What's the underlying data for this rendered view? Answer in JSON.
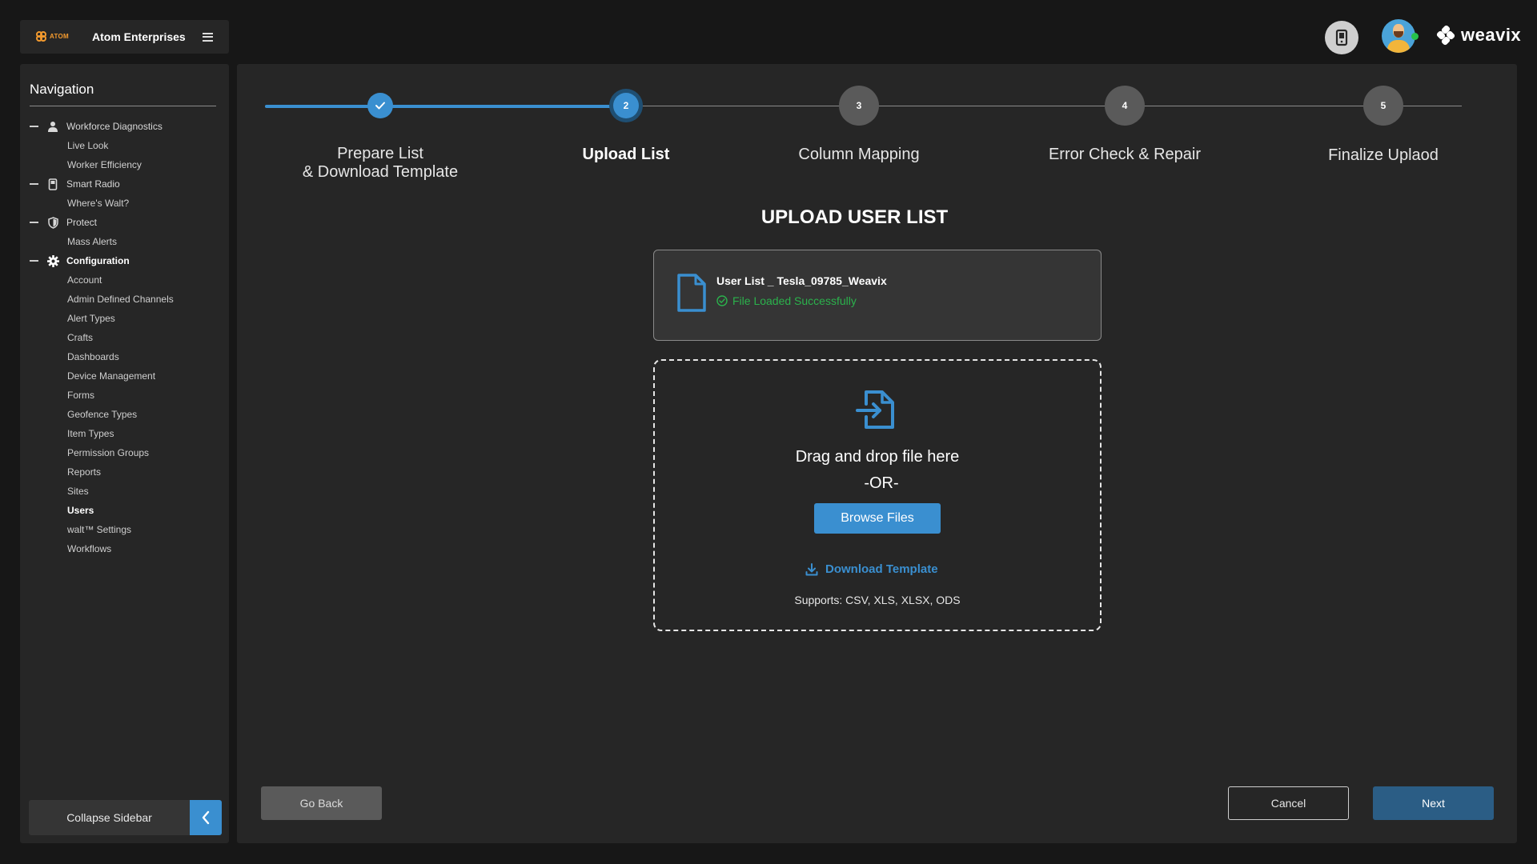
{
  "brand": {
    "logo_text": "ATOM",
    "company": "Atom Enterprises"
  },
  "header": {
    "product_logo": "weavix"
  },
  "sidebar": {
    "title": "Navigation",
    "groups": [
      {
        "label": "Workforce Diagnostics",
        "icon": "person-icon",
        "items": [
          "Live Look",
          "Worker Efficiency"
        ]
      },
      {
        "label": "Smart Radio",
        "icon": "radio-icon",
        "items": [
          "Where's Walt?"
        ]
      },
      {
        "label": "Protect",
        "icon": "shield-icon",
        "items": [
          "Mass Alerts"
        ]
      },
      {
        "label": "Configuration",
        "icon": "gear-icon",
        "items": [
          "Account",
          "Admin Defined Channels",
          "Alert Types",
          "Crafts",
          "Dashboards",
          "Device Management",
          "Forms",
          "Geofence Types",
          "Item Types",
          "Permission Groups",
          "Reports",
          "Sites",
          "Users",
          "walt™ Settings",
          "Workflows"
        ]
      }
    ],
    "active_item": "Users",
    "collapse_label": "Collapse Sidebar"
  },
  "wizard": {
    "steps": [
      {
        "number": "1",
        "line1": "Prepare List",
        "line2": "& Download Template",
        "state": "done"
      },
      {
        "number": "2",
        "line1": "Upload List",
        "line2": "",
        "state": "current"
      },
      {
        "number": "3",
        "line1": "Column Mapping",
        "line2": "",
        "state": "todo"
      },
      {
        "number": "4",
        "line1": "Error Check & Repair",
        "line2": "",
        "state": "todo"
      },
      {
        "number": "5",
        "line1": "Finalize Uplaod",
        "line2": "",
        "state": "todo"
      }
    ]
  },
  "upload": {
    "title": "UPLOAD USER LIST",
    "file_name": "User List _ Tesla_09785_Weavix",
    "file_status": "File Loaded Successfully",
    "drop_text": "Drag and drop file here",
    "or_text": "-OR-",
    "browse_label": "Browse Files",
    "download_label": "Download Template",
    "supports_text": "Supports: CSV, XLS, XLSX, ODS"
  },
  "footer": {
    "back_label": "Go Back",
    "cancel_label": "Cancel",
    "next_label": "Next"
  },
  "colors": {
    "accent": "#3a8fd0",
    "success": "#2bb24c",
    "brand_orange": "#f39a2e"
  }
}
